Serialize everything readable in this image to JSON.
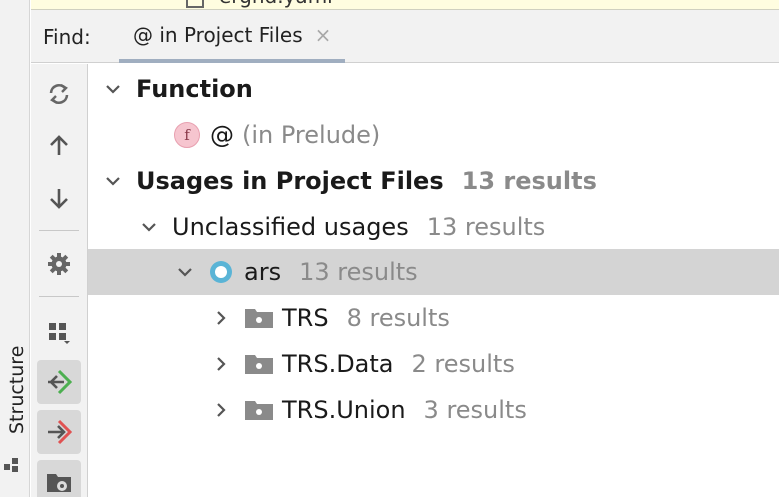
{
  "editor": {
    "filename_partial": "ergnd.yaml"
  },
  "sidebar": {
    "structure_label": "Structure"
  },
  "find": {
    "label": "Find:",
    "tab_label": "@ in Project Files",
    "close_glyph": "×"
  },
  "toolbar": {
    "buttons": [
      "rerun-icon",
      "up-arrow-icon",
      "down-arrow-icon",
      "settings-icon",
      "group-by-icon",
      "merge-green-icon",
      "merge-red-icon",
      "module-folder-icon"
    ]
  },
  "tree": {
    "function_header": "Function",
    "function_item": {
      "badge": "f",
      "name": "@",
      "location": "(in Prelude)"
    },
    "usages_header": "Usages in Project Files",
    "usages_count": "13 results",
    "unclassified": {
      "label": "Unclassified usages",
      "count": "13 results"
    },
    "module": {
      "name": "ars",
      "count": "13 results"
    },
    "packages": [
      {
        "name": "TRS",
        "count": "8 results"
      },
      {
        "name": "TRS.Data",
        "count": "2 results"
      },
      {
        "name": "TRS.Union",
        "count": "3 results"
      }
    ]
  },
  "colors": {
    "selection": "#d4d4d4",
    "module_accent": "#5ab4d6",
    "merge_green": "#4caf50",
    "merge_red": "#e05252",
    "function_badge": "#f6c5cf"
  }
}
